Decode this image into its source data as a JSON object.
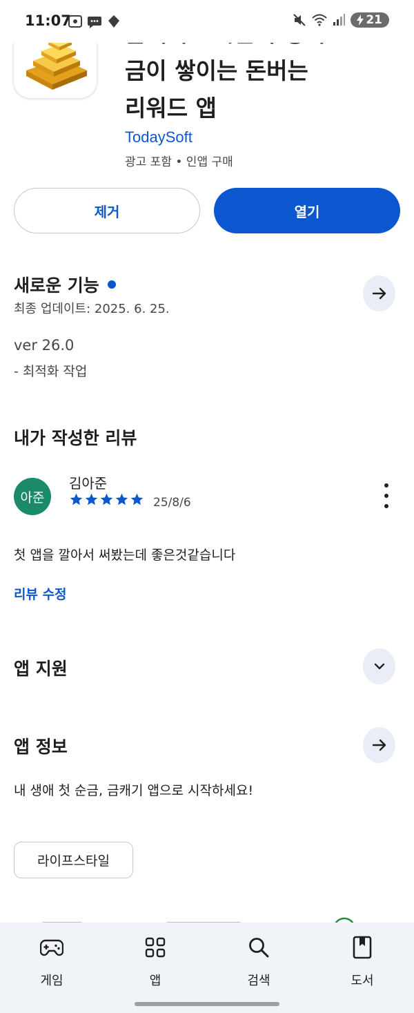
{
  "status_bar": {
    "time": "11:07",
    "battery": "21"
  },
  "app": {
    "title_lines": [
      "금캐기 - 시간이 쌓이고",
      "금이 쌓이는 돈버는",
      "리워드 앱"
    ],
    "developer": "TodaySoft",
    "meta": "광고 포함 • 인앱 구매",
    "remove_label": "제거",
    "open_label": "열기"
  },
  "whats_new": {
    "title": "새로운 기능",
    "updated": "최종 업데이트: 2025. 6. 25.",
    "version": "ver 26.0",
    "notes": "- 최적화 작업"
  },
  "my_review": {
    "title": "내가 작성한 리뷰",
    "avatar_text": "아준",
    "reviewer": "김아준",
    "rating": 5,
    "date": "25/8/6",
    "text": "첫 앱을 깔아서 써봤는데 좋은것같습니다",
    "edit_label": "리뷰 수정"
  },
  "app_support": {
    "title": "앱 지원"
  },
  "app_info": {
    "title": "앱 정보",
    "description": "내 생애 첫 순금, 금캐기 앱으로 시작하세요!",
    "category_chip": "라이프스타일"
  },
  "colors": {
    "accent": "#0b57d0",
    "avatar": "#1a8a6a",
    "nav_bg": "#f0f4f9",
    "round_button_bg": "#e9eef6"
  },
  "bottom_nav": {
    "items": [
      {
        "label": "게임",
        "icon": "gamepad-icon"
      },
      {
        "label": "앱",
        "icon": "apps-grid-icon"
      },
      {
        "label": "검색",
        "icon": "search-icon"
      },
      {
        "label": "도서",
        "icon": "book-icon"
      }
    ]
  }
}
